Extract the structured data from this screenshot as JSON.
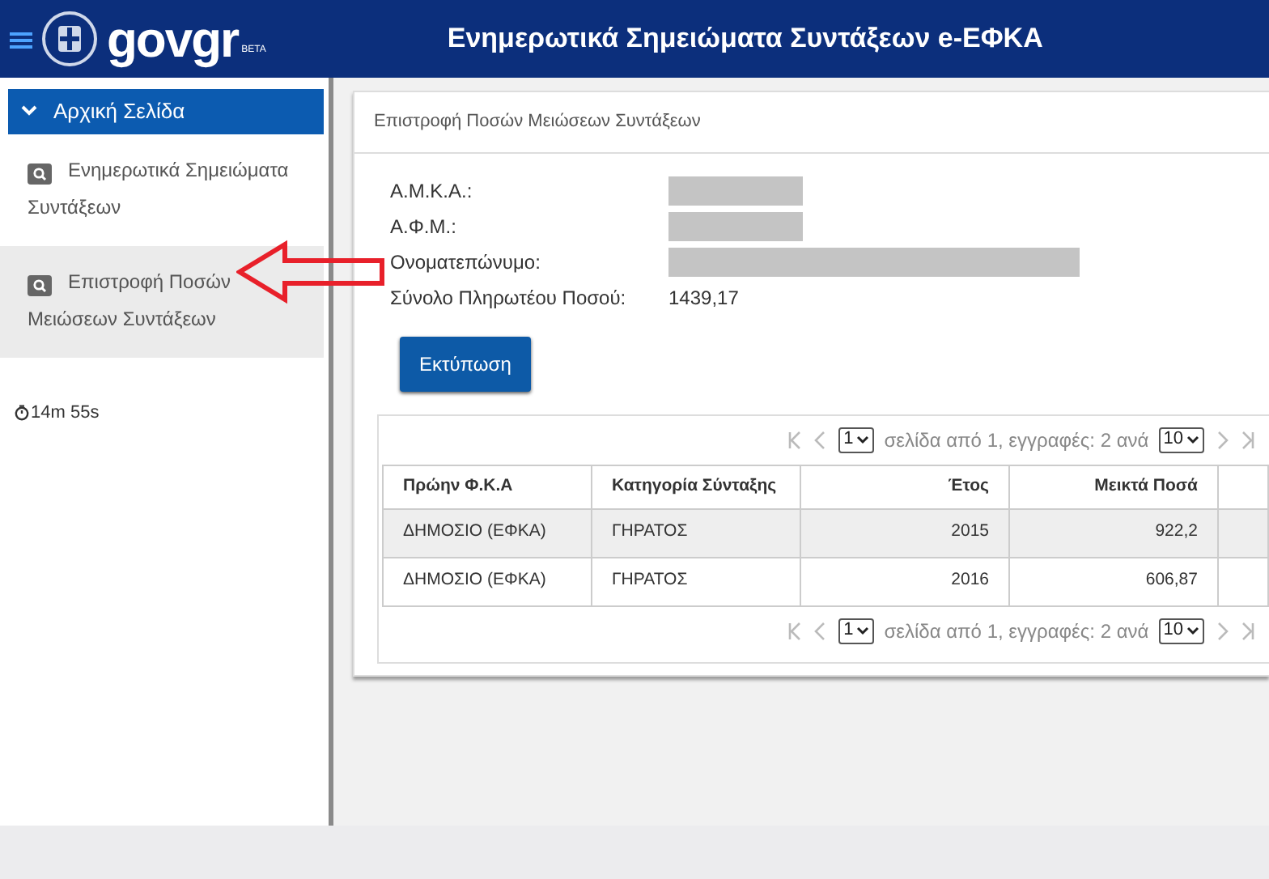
{
  "header": {
    "logo": "govgr",
    "logo_badge": "BETA",
    "title": "Ενημερωτικά Σημειώματα Συντάξεων e-ΕΦΚΑ"
  },
  "sidebar": {
    "heading": {
      "label": "Αρχική Σελίδα",
      "expanded": true
    },
    "items": [
      {
        "label": "Ενημερωτικά Σημειώματα Συντάξεων",
        "selected": false
      },
      {
        "label": "Επιστροφή Ποσών Μειώσεων Συντάξεων",
        "selected": true
      }
    ],
    "timer": "14m 55s"
  },
  "panel": {
    "title": "Επιστροφή Ποσών Μειώσεων Συντάξεων",
    "fields": [
      {
        "label": "Α.Μ.Κ.Α.:",
        "kind": "masked"
      },
      {
        "label": "Α.Φ.Μ.:",
        "kind": "masked"
      },
      {
        "label": "Ονοματεπώνυμο:",
        "kind": "maskedwide"
      },
      {
        "label": "Σύνολο Πληρωτέου Ποσού:",
        "kind": "text",
        "value": "1439,17"
      }
    ],
    "print_button": "Εκτύπωση",
    "pager_top": {
      "page": "1",
      "info": "σελίδα από 1, εγγραφές: 2 ανά",
      "per_page": "10"
    },
    "table": {
      "columns": [
        "Πρώην Φ.Κ.Α",
        "Κατηγορία Σύνταξης",
        "Έτος",
        "Μεικτά Ποσά"
      ],
      "rows": [
        [
          "ΔΗΜΟΣΙΟ (ΕΦΚΑ)",
          "ΓΗΡΑΤΟΣ",
          "2015",
          "922,2"
        ],
        [
          "ΔΗΜΟΣΙΟ (ΕΦΚΑ)",
          "ΓΗΡΑΤΟΣ",
          "2016",
          "606,87"
        ]
      ]
    },
    "pager_bottom": {
      "page": "1",
      "info": "σελίδα από 1, εγγραφές: 2 ανά",
      "per_page": "10"
    }
  }
}
